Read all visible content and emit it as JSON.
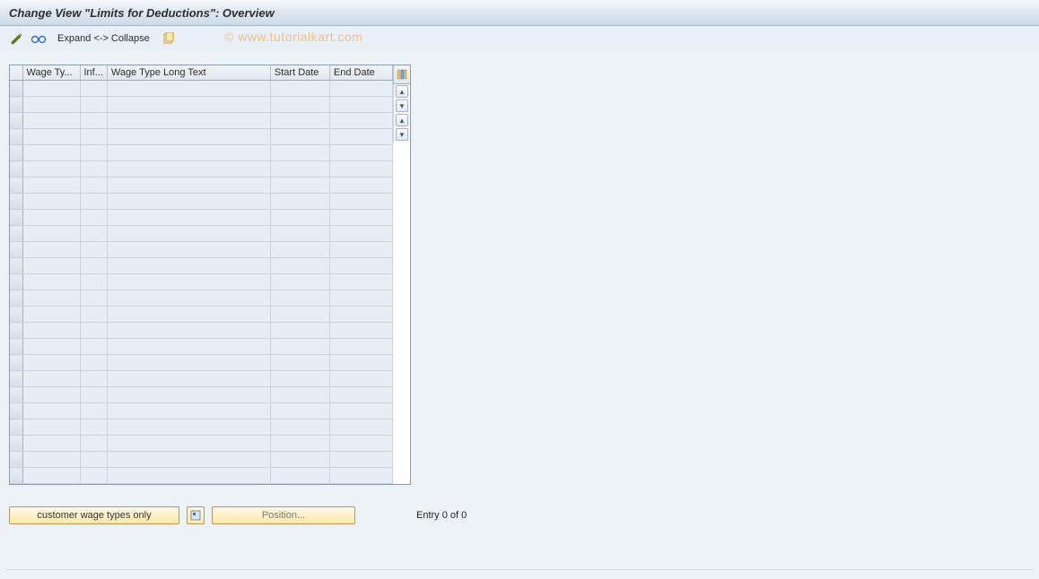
{
  "header": {
    "title": "Change View \"Limits for Deductions\": Overview"
  },
  "toolbar": {
    "expand_collapse_label": "Expand <-> Collapse"
  },
  "watermark": "© www.tutorialkart.com",
  "table": {
    "columns": {
      "wage_type": "Wage Ty...",
      "inf": "Inf...",
      "long_text": "Wage Type Long Text",
      "start_date": "Start Date",
      "end_date": "End Date"
    },
    "row_count": 25
  },
  "footer": {
    "customer_btn": "customer wage types only",
    "position_btn": "Position...",
    "entry_text": "Entry 0 of 0"
  }
}
